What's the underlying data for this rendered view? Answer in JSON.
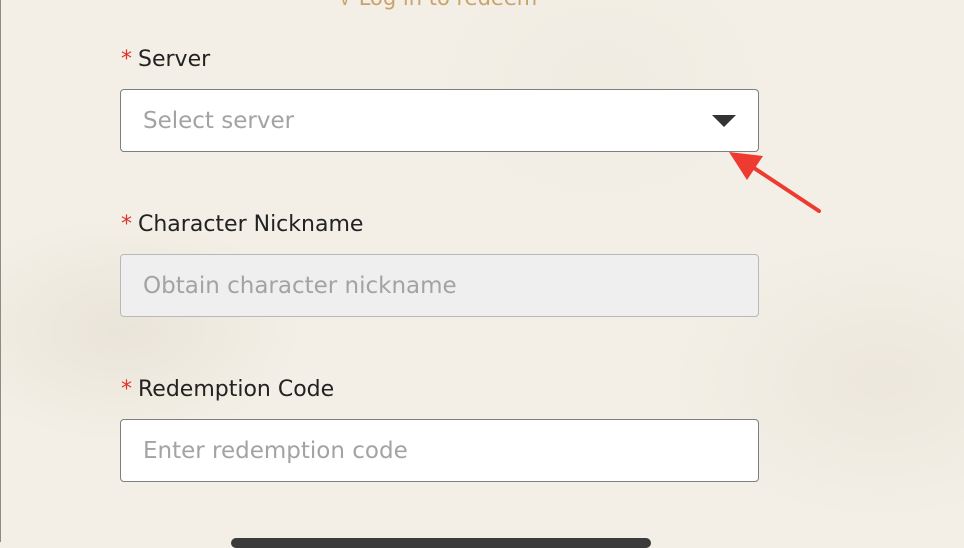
{
  "header": {
    "login_link": "Log in to redeem",
    "login_link_icon": "chevron-down-icon"
  },
  "form": {
    "required_marker": "*",
    "server": {
      "label": "Server",
      "placeholder": "Select server",
      "icon": "caret-down-icon"
    },
    "nickname": {
      "label": "Character Nickname",
      "placeholder": "Obtain character nickname"
    },
    "code": {
      "label": "Redemption Code",
      "placeholder": "Enter redemption code"
    }
  },
  "colors": {
    "required": "#e0332b",
    "annotation_arrow": "#ee3b32",
    "link": "#c9a36a",
    "background": "#f3efe6"
  }
}
